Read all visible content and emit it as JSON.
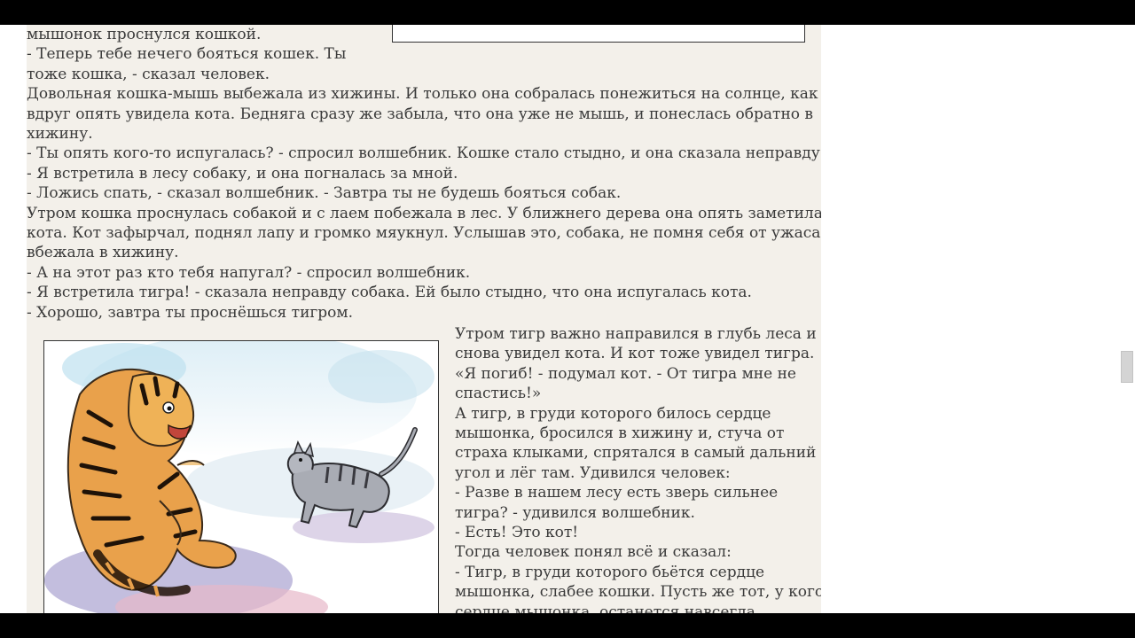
{
  "top_lines": [
    "мышонок проснулся кошкой.",
    "-   Теперь тебе нечего бояться кошек. Ты",
    "тоже кошка, - сказал человек.",
    "Довольная кошка-мышь выбежала из хижины. И только она собралась понежиться на солнце, как",
    "вдруг опять увидела кота. Бедняга сразу же забыла, что она уже не мышь, и понеслась обратно в",
    "хижину.",
    "-  Ты опять кого-то испугалась? - спросил волшебник. Кошке стало стыдно, и она сказала неправду:",
    "- Я встретила в лесу собаку, и она погналась за мной.",
    "-  Ложись спать, - сказал волшебник. - Завтра ты не будешь бояться собак.",
    "Утром кошка проснулась собакой и с лаем побежала в лес. У ближнего дерева она опять заметила",
    "кота. Кот зафырчал, поднял лапу и громко мяукнул. Услышав это, собака, не помня себя от ужаса,",
    "вбежала в хижину.",
    "- А на этот раз кто тебя напугал? - спросил волшебник.",
    "- Я встретила тигра! - сказала неправду собака. Ей было стыдно, что она испугалась кота.",
    "-  Хорошо, завтра ты проснёшься тигром."
  ],
  "right_lines": [
    "Утром тигр важно направился в глубь леса и",
    "снова увидел кота. И кот тоже увидел тигра.",
    "«Я погиб! - подумал кот. - От тигра мне не",
    "спастись!»",
    "А тигр, в груди которого билось сердце",
    "мышонка, бросился в хижину и, стуча от",
    "страха клыками, спрятался в самый дальний",
    "угол и лёг там. Удивился человек:",
    "- Разве в нашем лесу есть зверь сильнее",
    "тигра? - удивился волшебник.",
    "-  Есть! Это кот!",
    "Тогда человек понял всё и сказал:",
    "-  Тигр, в груди которого бьётся сердце",
    "мышонка, слабее кошки. Пусть же тот, у кого",
    "сердце мышонка, останется навсегда"
  ]
}
